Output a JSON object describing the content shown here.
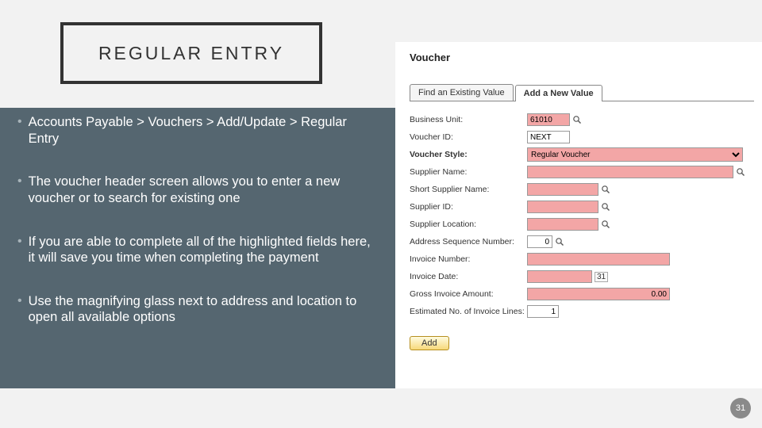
{
  "title": "REGULAR ENTRY",
  "bullets": [
    "Accounts Payable > Vouchers > Add/Update > Regular Entry",
    "The voucher header screen allows you to enter a new voucher or to search for existing one",
    "If you are able to complete all of the highlighted fields here, it will save you time when completing the payment",
    "Use the magnifying glass next to address and location to open all available options"
  ],
  "form": {
    "heading": "Voucher",
    "tabs": {
      "find": "Find an Existing Value",
      "add": "Add a New Value"
    },
    "labels": {
      "bu": "Business Unit:",
      "vid": "Voucher ID:",
      "style": "Voucher Style:",
      "sname": "Supplier Name:",
      "ssname": "Short Supplier Name:",
      "sid": "Supplier ID:",
      "sloc": "Supplier Location:",
      "aseq": "Address Sequence Number:",
      "invno": "Invoice Number:",
      "invdt": "Invoice Date:",
      "gross": "Gross Invoice Amount:",
      "lines": "Estimated No. of Invoice Lines:"
    },
    "values": {
      "bu": "61010",
      "vid": "NEXT",
      "style": "Regular Voucher",
      "aseq": "0",
      "gross": "0.00",
      "lines": "1"
    },
    "addBtn": "Add"
  },
  "pageNumber": "31"
}
